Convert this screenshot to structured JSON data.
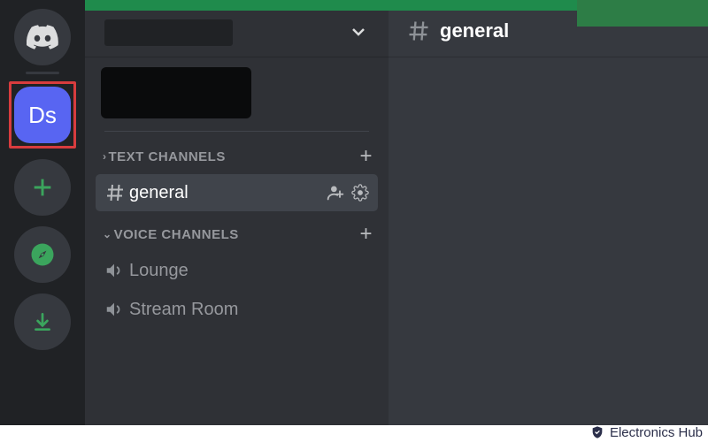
{
  "serverRail": {
    "selectedServerLabel": "Ds"
  },
  "sidebar": {
    "categories": [
      {
        "name": "TEXT CHANNELS",
        "collapsed": false,
        "channels": [
          {
            "name": "general",
            "active": true
          }
        ]
      },
      {
        "name": "VOICE CHANNELS",
        "collapsed": false,
        "channels": [
          {
            "name": "Lounge",
            "active": false
          },
          {
            "name": "Stream Room",
            "active": false
          }
        ]
      }
    ]
  },
  "main": {
    "channelTitle": "general"
  },
  "watermark": {
    "text": "Electronics Hub"
  },
  "colors": {
    "blurple": "#5865f2",
    "green": "#3ba55d",
    "headerGreen": "#1f8b4c",
    "highlight": "#d83c3e"
  }
}
